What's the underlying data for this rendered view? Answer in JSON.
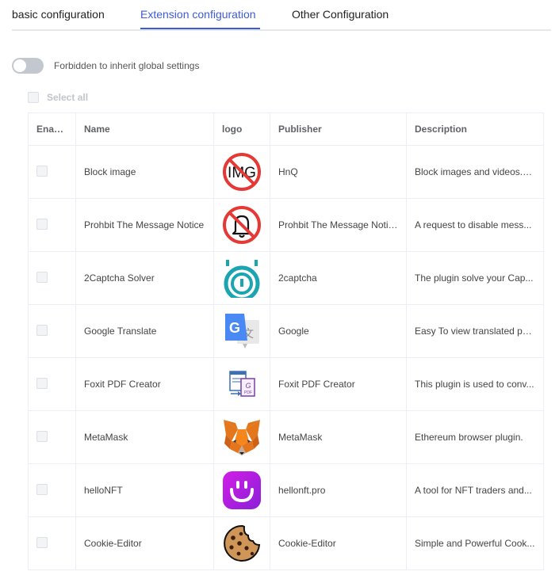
{
  "tabs": [
    {
      "label": "basic configuration",
      "active": false
    },
    {
      "label": "Extension configuration",
      "active": true
    },
    {
      "label": "Other Configuration",
      "active": false
    }
  ],
  "toggle": {
    "label": "Forbidden to inherit global settings",
    "on": false
  },
  "select_all": {
    "label": "Select all"
  },
  "table": {
    "columns": [
      "Enable",
      "Name",
      "logo",
      "Publisher",
      "Description"
    ],
    "rows": [
      {
        "name": "Block image",
        "logo": "block-image-logo",
        "publisher": "HnQ",
        "description": "Block images and videos.P..."
      },
      {
        "name": "Prohbit The Message Notice",
        "logo": "prohibit-notice-logo",
        "publisher": "Prohbit The Message Notice",
        "description": "A request to disable mess..."
      },
      {
        "name": "2Captcha Solver",
        "logo": "2captcha-logo",
        "publisher": "2captcha",
        "description": "The plugin solve your Cap..."
      },
      {
        "name": "Google Translate",
        "logo": "google-translate-logo",
        "publisher": "Google",
        "description": "Easy To view translated pa..."
      },
      {
        "name": "Foxit PDF Creator",
        "logo": "foxit-pdf-logo",
        "publisher": "Foxit PDF Creator",
        "description": "This plugin is used to conv..."
      },
      {
        "name": "MetaMask",
        "logo": "metamask-logo",
        "publisher": "MetaMask",
        "description": "Ethereum browser plugin."
      },
      {
        "name": "helloNFT",
        "logo": "hellonft-logo",
        "publisher": "hellonft.pro",
        "description": "A tool for NFT traders and..."
      },
      {
        "name": "Cookie-Editor",
        "logo": "cookie-editor-logo",
        "publisher": "Cookie-Editor",
        "description": "Simple and Powerful Cook..."
      }
    ]
  },
  "logo_text": {
    "block_image": "IMG",
    "foxit": "PDF"
  },
  "colors": {
    "accent": "#3b5bdb",
    "toggle_off": "#c3c8d0",
    "prohibit_red": "#e53935",
    "captcha_teal": "#1aa5b0",
    "hellonft_purple": "#b620e0"
  }
}
